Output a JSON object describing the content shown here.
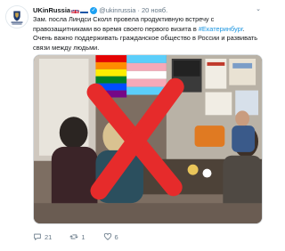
{
  "tweet": {
    "author_name": "UKinRussia",
    "handle": "@ukinrussia",
    "separator": "·",
    "date": "20 нояб.",
    "text_lines": [
      "Зам. посла Линдси Сколл провела продуктивную встречу с",
      "правозащитниками во время своего первого визита в ",
      "Очень важно поддерживать гражданское общество в России и развивать",
      "связи между людьми."
    ],
    "hashtag": "#Екатеринбург",
    "after_hashtag": ".",
    "stats": {
      "replies": "21",
      "retweets": "1",
      "likes": "6"
    }
  },
  "icons": {
    "avatar": "british-embassy-crest-icon",
    "verified": "verified-check-icon",
    "menu": "chevron-down-icon",
    "reply": "reply-icon",
    "retweet": "retweet-icon",
    "like": "heart-icon"
  },
  "colors": {
    "link": "#1b95e0",
    "verified": "#1da1f2",
    "muted": "#657786",
    "red_cross": "#e62b2b"
  }
}
